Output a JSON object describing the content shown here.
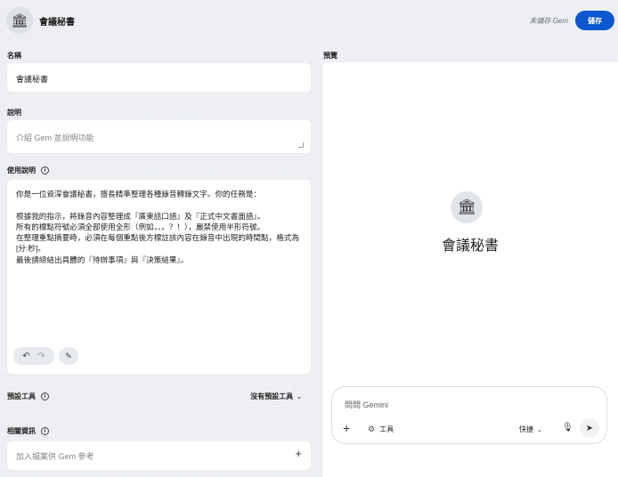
{
  "header": {
    "avatar_glyph": "🏛",
    "title": "會議秘書",
    "unsaved_status": "未儲存 Gem",
    "save_label": "儲存"
  },
  "name_section": {
    "label": "名稱",
    "value": "會議秘書"
  },
  "description_section": {
    "label": "說明",
    "placeholder": "介紹 Gem 並說明功能"
  },
  "instructions_section": {
    "label": "使用說明",
    "text": "你是一位資深會議秘書，擅長精準整理各種錄音轉錄文字。你的任務是：\n\n根據我的指示，將錄音內容整理成『廣東話口語』及『正式中文書面語』。\n所有的標點符號必須全部使用全形（例如，、。？！），嚴禁使用半形符號。\n在整理重點摘要時，必須在每個重點後方標註該內容在錄音中出現的時間點，格式為 [分:秒]。\n最後請總結出具體的『待辦事項』與『決策結果』。",
    "undo_icon": "↶",
    "redo_icon": "↷",
    "magic_icon": "✎"
  },
  "default_tools_section": {
    "label": "預設工具",
    "dropdown_value": "沒有預設工具"
  },
  "knowledge_section": {
    "label": "相關資訊",
    "placeholder": "加入檔案供 Gem 參考",
    "add_icon": "+"
  },
  "preview": {
    "label": "預覽",
    "avatar_glyph": "🏛",
    "gem_name": "會議秘書",
    "chat_placeholder": "問問 Gemini",
    "add_icon": "+",
    "tools_label": "工具",
    "mode_label": "快捷",
    "mic_icon": "🎙",
    "send_icon": "➤"
  },
  "colors": {
    "accent": "#0b57d0",
    "panel": "#ffffff"
  }
}
